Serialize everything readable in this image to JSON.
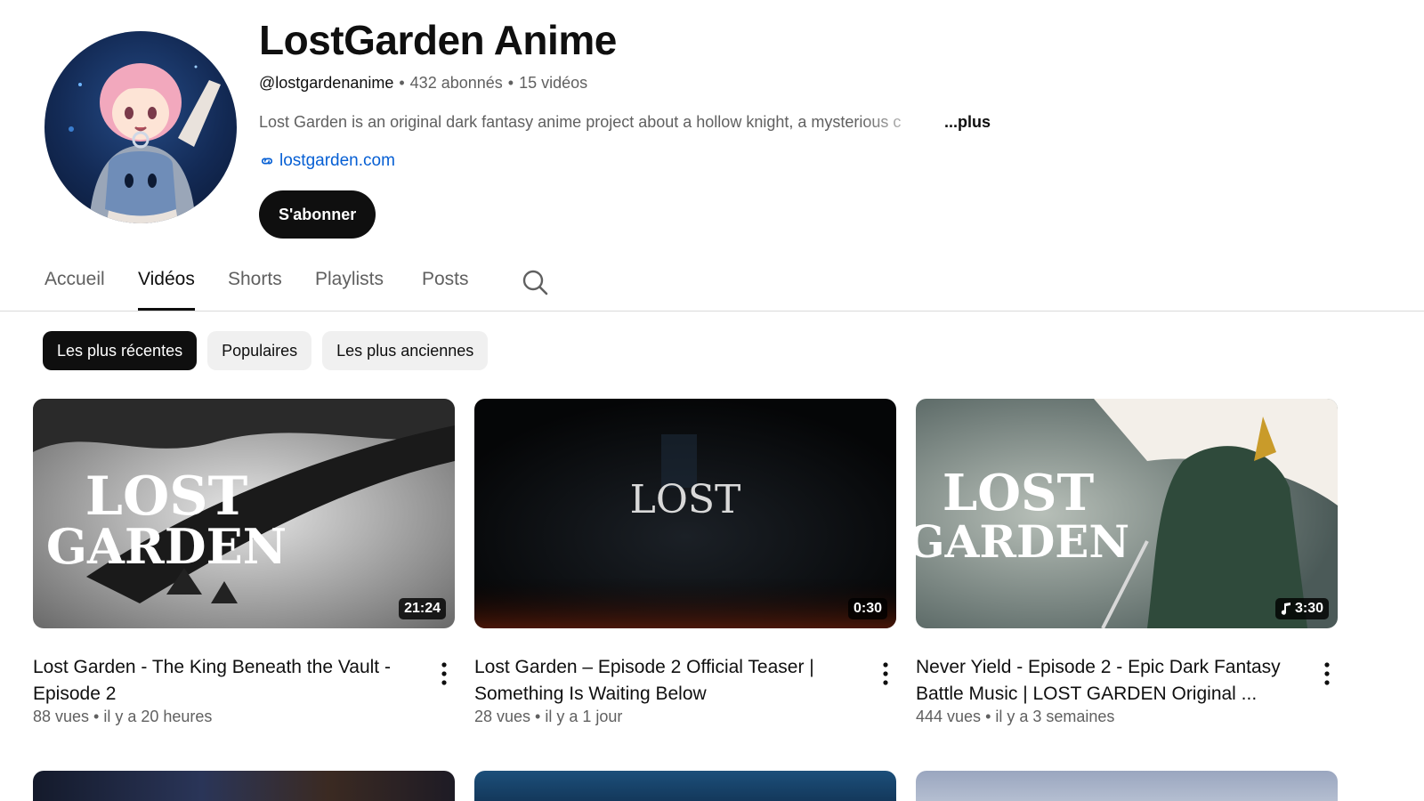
{
  "channel": {
    "name": "LostGarden Anime",
    "handle": "@lostgardenanime",
    "subscribers": "432 abonnés",
    "videos_count": "15 vidéos",
    "description": "Lost Garden is an original dark fantasy anime project about a hollow knight, a mysterious c",
    "more_label": "...plus",
    "link": "lostgarden.com",
    "subscribe_label": "S'abonner"
  },
  "tabs": [
    {
      "label": "Accueil"
    },
    {
      "label": "Vidéos",
      "active": true
    },
    {
      "label": "Shorts"
    },
    {
      "label": "Playlists"
    },
    {
      "label": "Posts"
    }
  ],
  "filters": [
    {
      "label": "Les plus récentes",
      "active": true
    },
    {
      "label": "Populaires"
    },
    {
      "label": "Les plus anciennes"
    }
  ],
  "videos": [
    {
      "title": "Lost Garden - The King Beneath the Vault - Episode 2",
      "duration": "21:24",
      "views": "88 vues",
      "age": "il y a 20 heures",
      "thumb_text_1": "LOST",
      "thumb_text_2": "GARDEN"
    },
    {
      "title": "Lost Garden – Episode 2 Official Teaser | Something Is Waiting Below",
      "duration": "0:30",
      "views": "28 vues",
      "age": "il y a 1 jour",
      "thumb_text_1": "LOST"
    },
    {
      "title": "Never Yield -  Episode 2 - Epic Dark Fantasy Battle Music | LOST GARDEN Original ...",
      "duration": "3:30",
      "views": "444 vues",
      "age": "il y a 3 semaines",
      "thumb_text_1": "LOST",
      "thumb_text_2": "GARDEN"
    }
  ],
  "icons": {
    "link": "link-icon",
    "search": "search-icon",
    "more": "kebab-menu-icon",
    "music": "music-note-icon"
  },
  "colors": {
    "link": "#065fd4",
    "primary": "#0f0f0f",
    "secondary": "#606060",
    "chip_bg": "#f0f0f0"
  }
}
